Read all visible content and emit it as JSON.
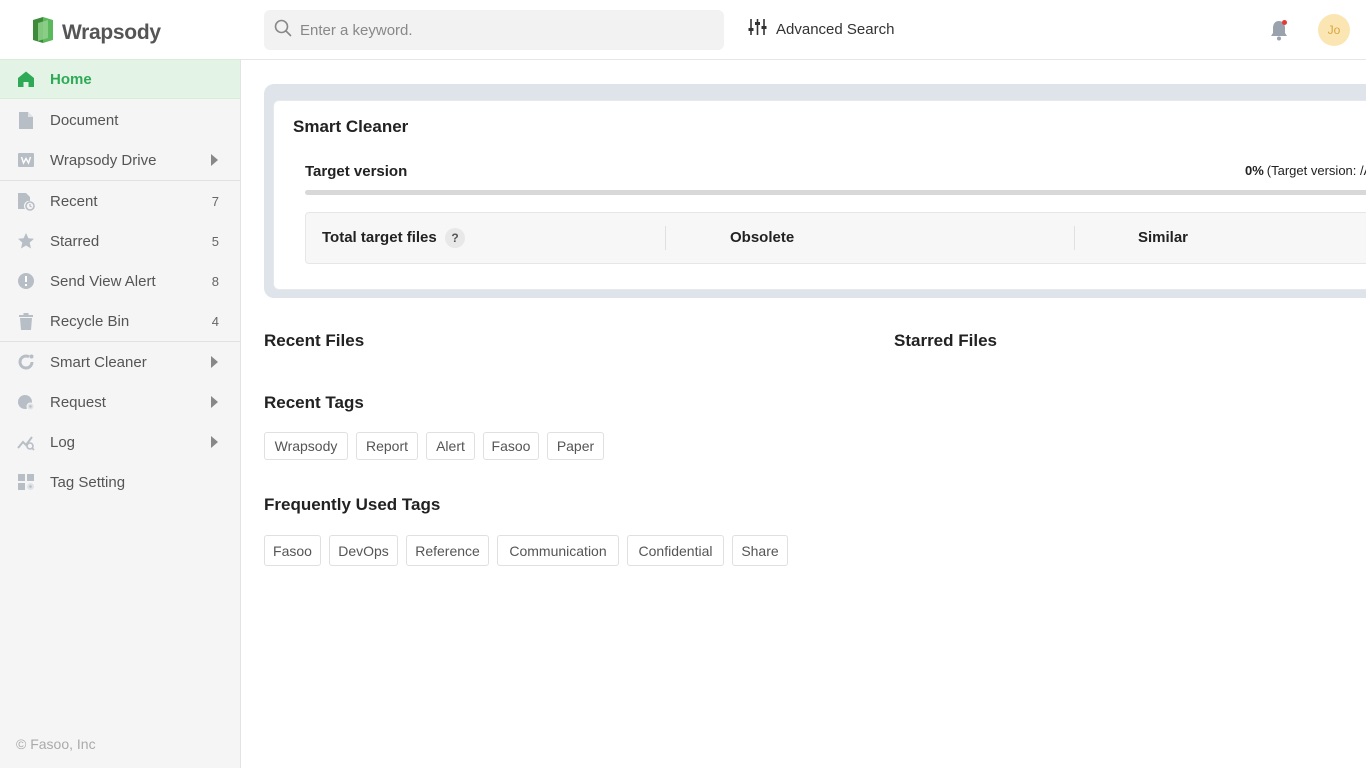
{
  "app": {
    "name": "Wrapsody"
  },
  "header": {
    "search_placeholder": "Enter a keyword.",
    "advanced_search_label": "Advanced Search",
    "avatar_initials": "Jo"
  },
  "colors": {
    "accent": "#2eaa56",
    "active_bg": "#e3f4e6",
    "panel_bg": "#dfe4ea",
    "notification_dot": "#e53935"
  },
  "sidebar": {
    "items": [
      {
        "label": "Home",
        "icon": "home-icon",
        "active": true
      },
      {
        "label": "Document",
        "icon": "document-icon"
      },
      {
        "label": "Wrapsody Drive",
        "icon": "drive-icon",
        "expandable": true
      },
      {
        "label": "Recent",
        "icon": "recent-icon",
        "count": "7"
      },
      {
        "label": "Starred",
        "icon": "star-icon",
        "count": "5"
      },
      {
        "label": "Send View Alert",
        "icon": "alert-icon",
        "count": "8"
      },
      {
        "label": "Recycle Bin",
        "icon": "trash-icon",
        "count": "4"
      },
      {
        "label": "Smart Cleaner",
        "icon": "smart-cleaner-icon",
        "expandable": true
      },
      {
        "label": "Request",
        "icon": "request-icon",
        "expandable": true
      },
      {
        "label": "Log",
        "icon": "log-icon",
        "expandable": true
      },
      {
        "label": "Tag Setting",
        "icon": "tag-setting-icon"
      }
    ],
    "copyright": "© Fasoo, Inc"
  },
  "smart_cleaner": {
    "title": "Smart Cleaner",
    "target_version_label": "Target version",
    "percent": "0%",
    "target_version_detail": "(Target version: /A",
    "progress": 0,
    "stats": {
      "total_target_files": "Total target files",
      "help": "?",
      "obsolete": "Obsolete",
      "similar": "Similar"
    }
  },
  "sections": {
    "recent_files": "Recent Files",
    "starred_files": "Starred Files",
    "recent_tags": "Recent Tags",
    "frequent_tags": "Frequently Used Tags"
  },
  "recent_tags": [
    "Wrapsody",
    "Report",
    "Alert",
    "Fasoo",
    "Paper"
  ],
  "frequent_tags": [
    "Fasoo",
    "DevOps",
    "Reference",
    "Communication",
    "Confidential",
    "Share"
  ]
}
